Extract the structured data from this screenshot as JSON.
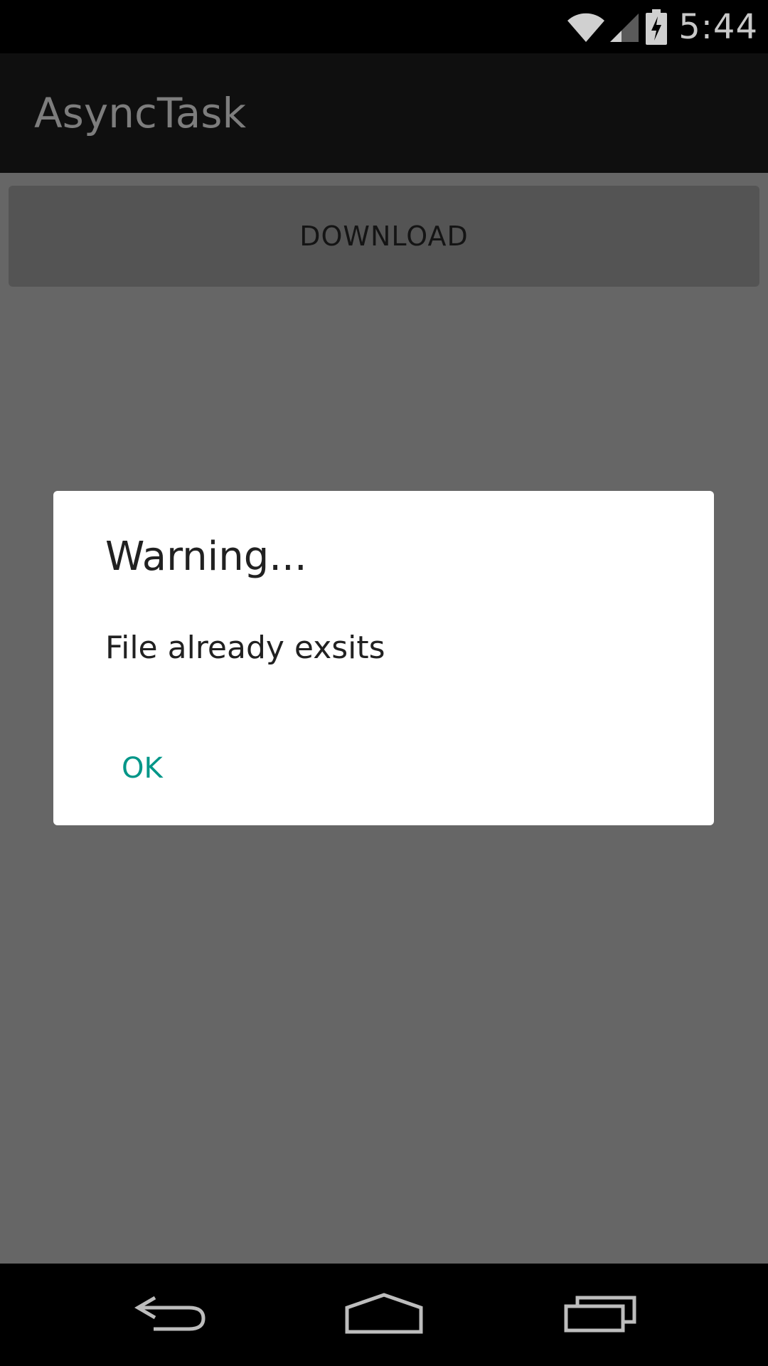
{
  "status_bar": {
    "time": "5:44",
    "icons": [
      "wifi-icon",
      "signal-icon",
      "battery-charging-icon"
    ]
  },
  "action_bar": {
    "title": "AsyncTask"
  },
  "content": {
    "download_label": "DOWNLOAD"
  },
  "dialog": {
    "title": "Warning...",
    "message": "File already exsits",
    "ok_label": "OK"
  },
  "nav_bar": {
    "icons": [
      "back-icon",
      "home-icon",
      "recents-icon"
    ]
  },
  "colors": {
    "accent": "#009688",
    "scrim_background": "#666666",
    "action_bar": "#0f0f0f",
    "status_bar": "#000000"
  }
}
